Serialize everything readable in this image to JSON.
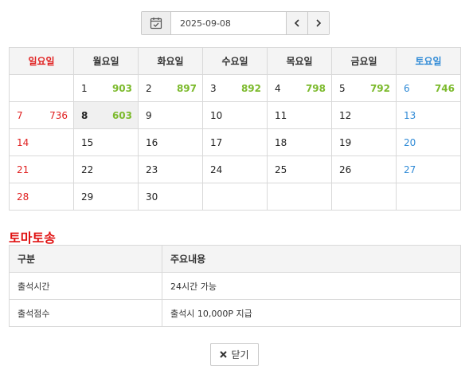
{
  "datebar": {
    "date": "2025-09-08",
    "calendar_icon": "calendar-check-icon",
    "prev_icon": "chevron-left-icon",
    "next_icon": "chevron-right-icon"
  },
  "calendar": {
    "weekdays": [
      "일요일",
      "월요일",
      "화요일",
      "수요일",
      "목요일",
      "금요일",
      "토요일"
    ],
    "weeks": [
      [
        {
          "day": "",
          "count": ""
        },
        {
          "day": "1",
          "count": "903"
        },
        {
          "day": "2",
          "count": "897"
        },
        {
          "day": "3",
          "count": "892"
        },
        {
          "day": "4",
          "count": "798"
        },
        {
          "day": "5",
          "count": "792"
        },
        {
          "day": "6",
          "count": "746"
        }
      ],
      [
        {
          "day": "7",
          "count": "736"
        },
        {
          "day": "8",
          "count": "603"
        },
        {
          "day": "9",
          "count": ""
        },
        {
          "day": "10",
          "count": ""
        },
        {
          "day": "11",
          "count": ""
        },
        {
          "day": "12",
          "count": ""
        },
        {
          "day": "13",
          "count": ""
        }
      ],
      [
        {
          "day": "14",
          "count": ""
        },
        {
          "day": "15",
          "count": ""
        },
        {
          "day": "16",
          "count": ""
        },
        {
          "day": "17",
          "count": ""
        },
        {
          "day": "18",
          "count": ""
        },
        {
          "day": "19",
          "count": ""
        },
        {
          "day": "20",
          "count": ""
        }
      ],
      [
        {
          "day": "21",
          "count": ""
        },
        {
          "day": "22",
          "count": ""
        },
        {
          "day": "23",
          "count": ""
        },
        {
          "day": "24",
          "count": ""
        },
        {
          "day": "25",
          "count": ""
        },
        {
          "day": "26",
          "count": ""
        },
        {
          "day": "27",
          "count": ""
        }
      ],
      [
        {
          "day": "28",
          "count": ""
        },
        {
          "day": "29",
          "count": ""
        },
        {
          "day": "30",
          "count": ""
        },
        {
          "day": "",
          "count": ""
        },
        {
          "day": "",
          "count": ""
        },
        {
          "day": "",
          "count": ""
        },
        {
          "day": "",
          "count": ""
        }
      ]
    ],
    "today": "8",
    "colors": {
      "sunday": "#e02020",
      "saturday": "#2f8ad6",
      "count": "#7cba2c"
    }
  },
  "info": {
    "title": "토마토송",
    "headers": [
      "구분",
      "주요내용"
    ],
    "rows": [
      [
        "출석시간",
        "24시간 가능"
      ],
      [
        "출석점수",
        "출석시 10,000P 지급"
      ]
    ]
  },
  "footer": {
    "close_label": "닫기",
    "close_icon": "close-x-icon"
  }
}
